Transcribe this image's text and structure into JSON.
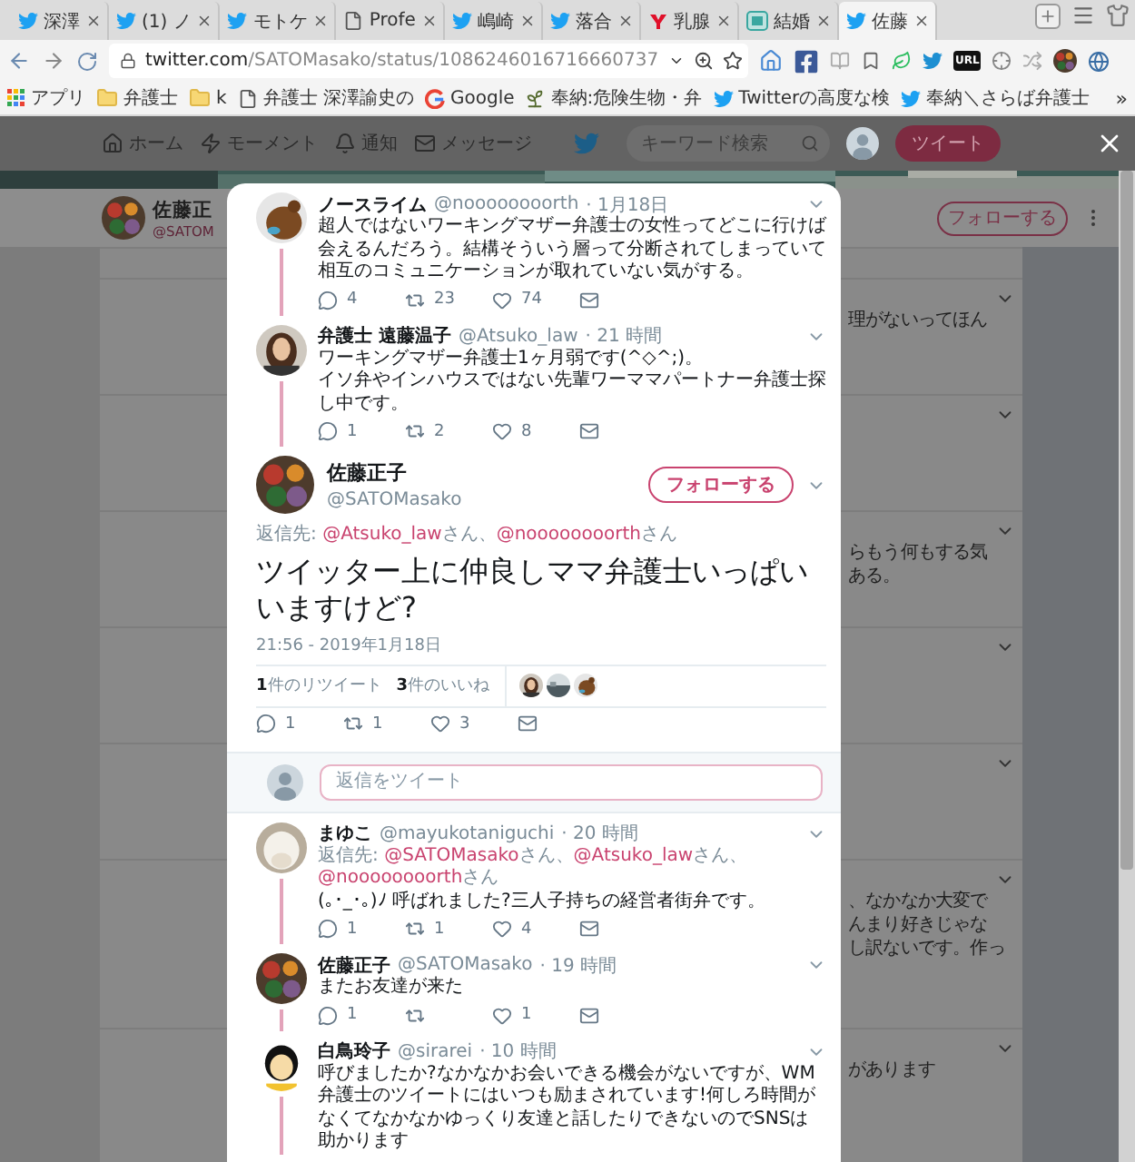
{
  "browser": {
    "tabs": [
      {
        "label": "深澤",
        "kind": "twitter",
        "selected": false
      },
      {
        "label": "(1) ノ",
        "kind": "twitter",
        "selected": false
      },
      {
        "label": "モトケ",
        "kind": "twitter",
        "selected": false
      },
      {
        "label": "Profe",
        "kind": "page",
        "selected": false
      },
      {
        "label": "嶋崎",
        "kind": "twitter",
        "selected": false
      },
      {
        "label": "落合",
        "kind": "twitter",
        "selected": false
      },
      {
        "label": "乳腺",
        "kind": "yahoo",
        "selected": false
      },
      {
        "label": "結婚",
        "kind": "site",
        "selected": false
      },
      {
        "label": "佐藤",
        "kind": "twitter",
        "selected": true
      }
    ],
    "url": {
      "host": "twitter.com",
      "path": "/SATOMasako/status/1086246016716660737"
    },
    "extension_badge": "URL",
    "bookmarks": [
      {
        "label": "アプリ",
        "kind": "apps"
      },
      {
        "label": "弁護士",
        "kind": "folder"
      },
      {
        "label": "k",
        "kind": "folder"
      },
      {
        "label": "弁護士 深澤諭史の",
        "kind": "page"
      },
      {
        "label": "Google",
        "kind": "google"
      },
      {
        "label": "奉納:危険生物・弁",
        "kind": "plant"
      },
      {
        "label": "Twitterの高度な検",
        "kind": "twitter"
      },
      {
        "label": "奉納＼さらば弁護士",
        "kind": "twitter"
      }
    ],
    "bookmarks_more": "»"
  },
  "twitter_nav": {
    "items": [
      {
        "label": "ホーム",
        "kind": "home"
      },
      {
        "label": "モーメント",
        "kind": "moments"
      },
      {
        "label": "通知",
        "kind": "notifications"
      },
      {
        "label": "メッセージ",
        "kind": "messages"
      }
    ],
    "search_placeholder": "キーワード検索",
    "tweet_button": "ツイート"
  },
  "background": {
    "name": "佐藤正",
    "handle": "@SATOM",
    "follow_button": "フォローする",
    "timeline": [
      {
        "kind": "text",
        "lines": [
          "理がないってほん"
        ]
      },
      {
        "kind": "blank"
      },
      {
        "kind": "text",
        "lines": [
          "らもう何もする気",
          "ある。"
        ]
      },
      {
        "kind": "blank"
      },
      {
        "kind": "blank"
      },
      {
        "kind": "text",
        "lines": [
          "、なかなか大変で",
          "んまり好きじゃな",
          "し訳ないです。作っ"
        ]
      },
      {
        "kind": "text",
        "lines": [
          "があります"
        ]
      }
    ]
  },
  "modal": {
    "thread": [
      {
        "name": "ノースライム",
        "handle": "@noooooooorth",
        "time": "· 1月18日",
        "lines": [
          "超人ではないワーキングマザー弁護士の女性ってどこに行けば会えるんだろう。結構そういう層って分断されてしまっていて相互のコミュニケーションが取れていない気がする。"
        ],
        "actions": [
          {
            "kind": "reply",
            "count": "4"
          },
          {
            "kind": "retweet",
            "count": "23"
          },
          {
            "kind": "like",
            "count": "74"
          },
          {
            "kind": "mail"
          }
        ]
      },
      {
        "name": "弁護士 遠藤温子",
        "handle": "@Atsuko_law",
        "time": "· 21 時間",
        "lines": [
          "ワーキングマザー弁護士1ヶ月弱です(^◇^;)。",
          "イソ弁やインハウスではない先輩ワーママパートナー弁護士探し中です。"
        ],
        "actions": [
          {
            "kind": "reply",
            "count": "1"
          },
          {
            "kind": "retweet",
            "count": "2"
          },
          {
            "kind": "like",
            "count": "8"
          },
          {
            "kind": "mail"
          }
        ]
      }
    ],
    "main_tweet": {
      "name": "佐藤正子",
      "handle": "@SATOMasako",
      "follow_button": "フォローする",
      "reply_to": {
        "label": "返信先:",
        "mentions": [
          {
            "handle": "@Atsuko_law",
            "suffix": "さん、"
          },
          {
            "handle": "@noooooooorth",
            "suffix": "さん"
          }
        ]
      },
      "text": "ツイッター上に仲良しママ弁護士いっぱいいますけど?",
      "timestamp": "21:56 - 2019年1月18日",
      "stats": [
        "**1**件のリツイート",
        "**3**件のいいね"
      ],
      "actions": [
        {
          "kind": "reply",
          "count": "1"
        },
        {
          "kind": "retweet",
          "count": "1"
        },
        {
          "kind": "like",
          "count": "3"
        },
        {
          "kind": "mail"
        }
      ]
    },
    "reply_box": {
      "placeholder": "返信をツイート"
    },
    "replies": [
      {
        "name": "まゆこ",
        "handle": "@mayukotaniguchi",
        "time": "· 20 時間",
        "reply_to": {
          "label": "返信先:",
          "mentions": [
            {
              "handle": "@SATOMasako",
              "suffix": "さん、"
            },
            {
              "handle": "@Atsuko_law",
              "suffix": "さん、"
            },
            {
              "handle": "@noooooooorth",
              "suffix": "さん"
            }
          ]
        },
        "lines": [
          "(｡･_･｡)ﾉ 呼ばれました?三人子持ちの経営者街弁です。"
        ],
        "actions": [
          {
            "kind": "reply",
            "count": "1"
          },
          {
            "kind": "retweet",
            "count": "1"
          },
          {
            "kind": "like",
            "count": "4"
          },
          {
            "kind": "mail"
          }
        ]
      },
      {
        "name": "佐藤正子",
        "handle": "@SATOMasako",
        "time": "· 19 時間",
        "lines": [
          "またお友達が来た"
        ],
        "actions": [
          {
            "kind": "reply",
            "count": "1"
          },
          {
            "kind": "retweet"
          },
          {
            "kind": "like",
            "count": "1"
          },
          {
            "kind": "mail"
          }
        ]
      },
      {
        "name": "白鳥玲子",
        "handle": "@sirarei",
        "time": "· 10 時間",
        "lines": [
          "呼びましたか?なかなかお会いできる機会がないですが、WM弁護士のツイートにはいつも励まされています!何しろ時間がなくてなかなかゆっくり友達と話したりできないのでSNSは助かります"
        ]
      }
    ]
  }
}
